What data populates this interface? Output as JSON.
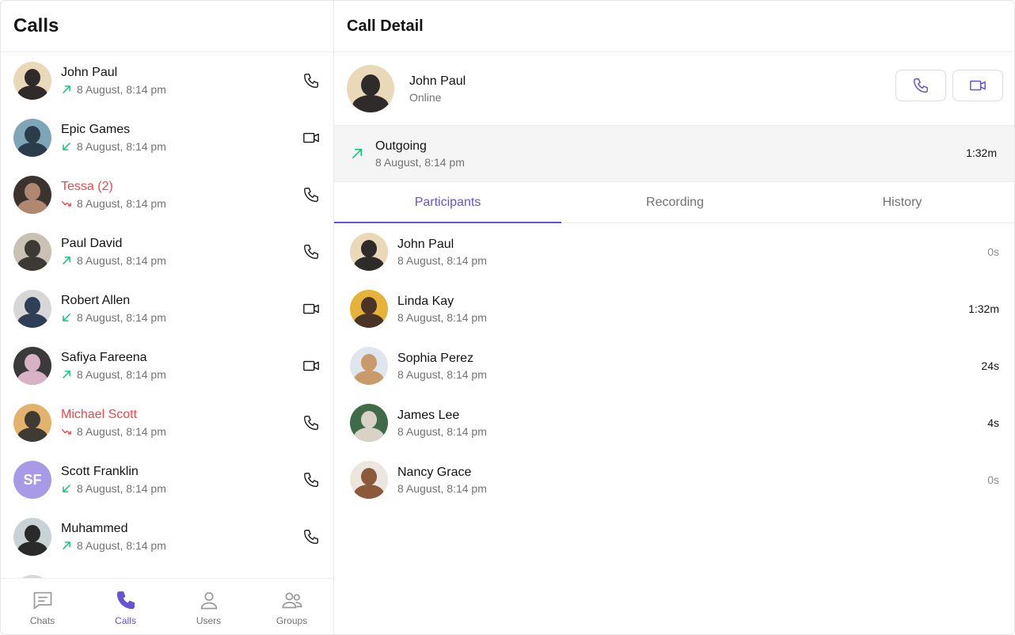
{
  "calls_panel": {
    "title": "Calls",
    "items": [
      {
        "name": "John Paul",
        "date": "8 August, 8:14 pm",
        "direction": "outgoing",
        "type": "audio",
        "missed": false,
        "avatar_bg": "#e9d9b8",
        "avatar_fg": "#2f2b2b"
      },
      {
        "name": "Epic Games",
        "date": "8 August, 8:14 pm",
        "direction": "incoming",
        "type": "video",
        "missed": false,
        "avatar_bg": "#7fa6b8",
        "avatar_fg": "#2b3d4a"
      },
      {
        "name": "Tessa (2)",
        "date": "8 August, 8:14 pm",
        "direction": "missed",
        "type": "audio",
        "missed": true,
        "avatar_bg": "#3a3330",
        "avatar_fg": "#b08870"
      },
      {
        "name": "Paul David",
        "date": "8 August, 8:14 pm",
        "direction": "outgoing",
        "type": "audio",
        "missed": false,
        "avatar_bg": "#c9c2b4",
        "avatar_fg": "#3d3a35"
      },
      {
        "name": "Robert Allen",
        "date": "8 August, 8:14 pm",
        "direction": "incoming",
        "type": "video",
        "missed": false,
        "avatar_bg": "#d7d7d7",
        "avatar_fg": "#2e3f57"
      },
      {
        "name": "Safiya Fareena",
        "date": "8 August, 8:14 pm",
        "direction": "outgoing",
        "type": "video",
        "missed": false,
        "avatar_bg": "#3a3a3a",
        "avatar_fg": "#d9b2c6"
      },
      {
        "name": "Michael Scott",
        "date": "8 August, 8:14 pm",
        "direction": "missed",
        "type": "audio",
        "missed": true,
        "avatar_bg": "#e2b36d",
        "avatar_fg": "#3f3a33"
      },
      {
        "name": "Scott Franklin",
        "date": "8 August, 8:14 pm",
        "direction": "incoming",
        "type": "audio",
        "missed": false,
        "avatar_bg": "#a99ae8",
        "initials": "SF"
      },
      {
        "name": "Muhammed",
        "date": "8 August, 8:14 pm",
        "direction": "outgoing",
        "type": "audio",
        "missed": false,
        "avatar_bg": "#c9d3d6",
        "avatar_fg": "#2a2a2a"
      }
    ]
  },
  "bottom_nav": {
    "items": [
      {
        "label": "Chats",
        "icon": "chat-icon",
        "active": false
      },
      {
        "label": "Calls",
        "icon": "phone-icon",
        "active": true
      },
      {
        "label": "Users",
        "icon": "user-icon",
        "active": false
      },
      {
        "label": "Groups",
        "icon": "group-icon",
        "active": false
      }
    ]
  },
  "detail": {
    "title": "Call Detail",
    "contact": {
      "name": "John Paul",
      "status": "Online",
      "avatar_bg": "#e9d9b8",
      "avatar_fg": "#2f2b2b"
    },
    "summary": {
      "title": "Outgoing",
      "date": "8 August, 8:14 pm",
      "duration": "1:32m"
    },
    "tabs": [
      {
        "label": "Participants",
        "active": true
      },
      {
        "label": "Recording",
        "active": false
      },
      {
        "label": "History",
        "active": false
      }
    ],
    "participants": [
      {
        "name": "John Paul",
        "date": "8 August, 8:14 pm",
        "duration": "0s",
        "zero": true,
        "avatar_bg": "#e9d9b8",
        "avatar_fg": "#2f2b2b"
      },
      {
        "name": "Linda Kay",
        "date": "8 August, 8:14 pm",
        "duration": "1:32m",
        "zero": false,
        "avatar_bg": "#e5b23a",
        "avatar_fg": "#4a3426"
      },
      {
        "name": "Sophia Perez",
        "date": "8 August, 8:14 pm",
        "duration": "24s",
        "zero": false,
        "avatar_bg": "#dfe6ee",
        "avatar_fg": "#c99a6a"
      },
      {
        "name": "James Lee",
        "date": "8 August, 8:14 pm",
        "duration": "4s",
        "zero": false,
        "avatar_bg": "#3f6b48",
        "avatar_fg": "#d9d2c7"
      },
      {
        "name": "Nancy Grace",
        "date": "8 August, 8:14 pm",
        "duration": "0s",
        "zero": true,
        "avatar_bg": "#ece6df",
        "avatar_fg": "#8a5a3a"
      }
    ]
  },
  "colors": {
    "accent": "#6852d6",
    "missed": "#f44649",
    "outgoing": "#09c26f",
    "text_secondary": "#727272"
  }
}
